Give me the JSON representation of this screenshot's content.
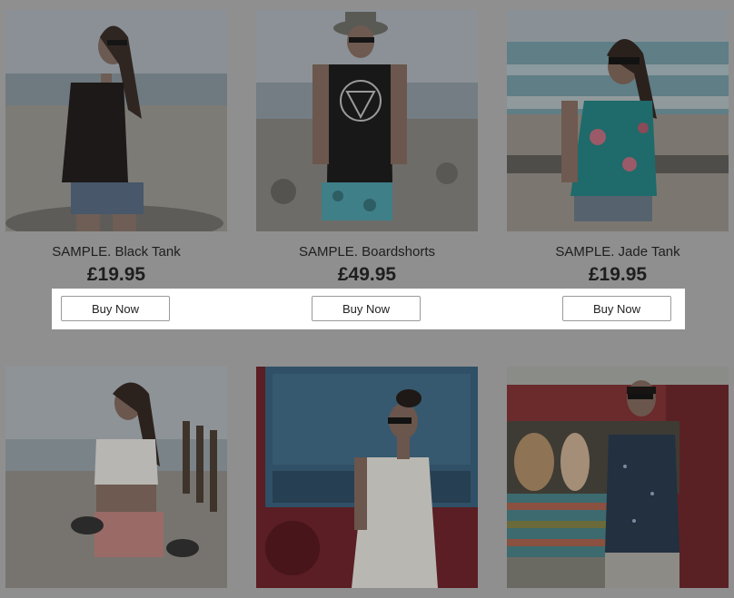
{
  "products": [
    {
      "title": "SAMPLE. Black Tank",
      "price": "£19.95",
      "button": "Buy Now"
    },
    {
      "title": "SAMPLE. Boardshorts",
      "price": "£49.95",
      "button": "Buy Now"
    },
    {
      "title": "SAMPLE. Jade Tank",
      "price": "£19.95",
      "button": "Buy Now"
    },
    {
      "title": "",
      "price": "",
      "button": ""
    },
    {
      "title": "",
      "price": "",
      "button": ""
    },
    {
      "title": "",
      "price": "",
      "button": ""
    }
  ],
  "colors": {
    "overlay": "#8f8f8f",
    "highlight": "#ffffff",
    "text": "#1e1e1e"
  }
}
